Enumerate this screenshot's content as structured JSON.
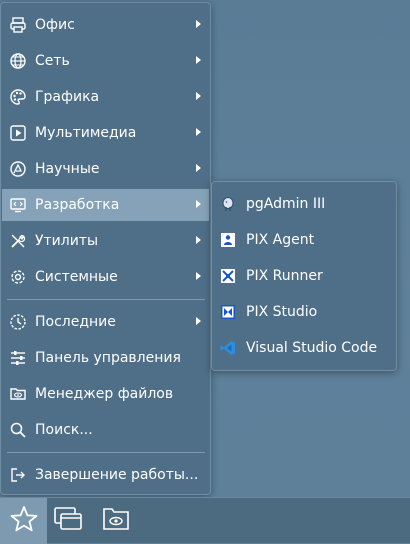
{
  "menu": {
    "items": [
      {
        "label": "Офис",
        "icon": "printer-icon",
        "submenu": true
      },
      {
        "label": "Сеть",
        "icon": "globe-icon",
        "submenu": true
      },
      {
        "label": "Графика",
        "icon": "palette-icon",
        "submenu": true
      },
      {
        "label": "Мультимедиа",
        "icon": "play-icon",
        "submenu": true
      },
      {
        "label": "Научные",
        "icon": "science-icon",
        "submenu": true
      },
      {
        "label": "Разработка",
        "icon": "code-icon",
        "submenu": true,
        "active": true
      },
      {
        "label": "Утилиты",
        "icon": "tools-icon",
        "submenu": true
      },
      {
        "label": "Системные",
        "icon": "gear-icon",
        "submenu": true
      },
      {
        "label": "Последние",
        "icon": "history-icon",
        "submenu": true
      },
      {
        "label": "Панель управления",
        "icon": "sliders-icon",
        "submenu": false
      },
      {
        "label": "Менеджер файлов",
        "icon": "file-manager-icon",
        "submenu": false
      },
      {
        "label": "Поиск...",
        "icon": "search-icon",
        "submenu": false
      },
      {
        "label": "Завершение работы...",
        "icon": "logout-icon",
        "submenu": false
      }
    ]
  },
  "submenu": {
    "items": [
      {
        "label": "pgAdmin III",
        "icon": "elephant-icon"
      },
      {
        "label": "PIX Agent",
        "icon": "pix-agent-icon"
      },
      {
        "label": "PIX Runner",
        "icon": "pix-runner-icon"
      },
      {
        "label": "PIX Studio",
        "icon": "pix-studio-icon"
      },
      {
        "label": "Visual Studio Code",
        "icon": "vscode-icon"
      }
    ]
  },
  "taskbar": {
    "start_icon": "star-icon",
    "buttons": [
      {
        "icon": "windows-icon"
      },
      {
        "icon": "folder-eye-icon"
      }
    ]
  },
  "colors": {
    "desktop": "#5d7f98",
    "menu_bg": "#4f6f88",
    "highlight": "#86a2b8",
    "taskbar": "#4c6a80"
  }
}
